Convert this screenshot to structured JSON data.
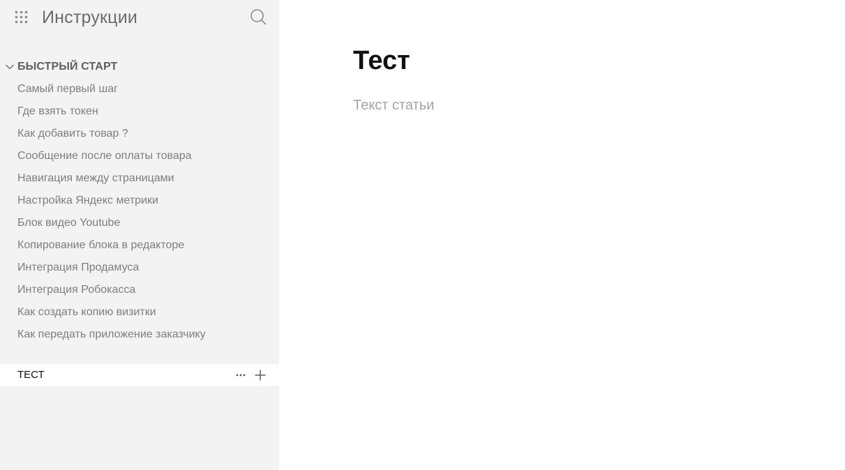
{
  "header": {
    "title": "Инструкции",
    "apps_icon": "grid-dots-icon",
    "search_icon": "search-icon"
  },
  "sidebar": {
    "section": {
      "title": "БЫСТРЫЙ СТАРТ",
      "expanded": true,
      "items": [
        {
          "label": "Самый первый шаг"
        },
        {
          "label": "Где взять токен"
        },
        {
          "label": "Как добавить товар ?"
        },
        {
          "label": "Сообщение после оплаты товара"
        },
        {
          "label": "Навигация между страницами"
        },
        {
          "label": "Настройка Яндекс метрики"
        },
        {
          "label": "Блок видео Youtube"
        },
        {
          "label": "Копирование блока в редакторе"
        },
        {
          "label": "Интеграция Продамуса"
        },
        {
          "label": "Интеграция Робокасса"
        },
        {
          "label": "Как создать копию визитки"
        },
        {
          "label": "Как передать приложение заказчику"
        }
      ]
    },
    "active_item": {
      "label": "ТЕСТ",
      "more_icon": "more-horizontal-icon",
      "add_icon": "plus-icon"
    }
  },
  "article": {
    "title": "Тест",
    "body": "Текст статьи"
  },
  "colors": {
    "sidebar_bg": "#f3f3f3",
    "active_row_bg": "#ffffff",
    "text_muted": "#7d7d7d",
    "placeholder": "#a5a5a5"
  }
}
